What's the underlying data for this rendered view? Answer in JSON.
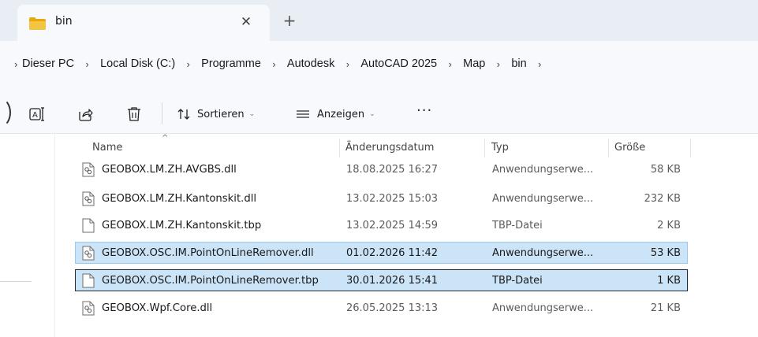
{
  "tab": {
    "title": "bin",
    "close_glyph": "✕",
    "new_tab_glyph": "+"
  },
  "breadcrumb": {
    "items": [
      "Dieser PC",
      "Local Disk (C:)",
      "Programme",
      "Autodesk",
      "AutoCAD 2025",
      "Map",
      "bin"
    ],
    "separator": "›"
  },
  "toolbar": {
    "sort_label": "Sortieren",
    "view_label": "Anzeigen",
    "more_label": "···",
    "chevron": "⌄"
  },
  "columns": {
    "name": "Name",
    "date": "Änderungsdatum",
    "type": "Typ",
    "size": "Größe",
    "sort_caret": "^"
  },
  "files": [
    {
      "name": "GEOBOX.LM.ZH.AVGBS.dll",
      "date": "18.08.2025 16:27",
      "type": "Anwendungserwe...",
      "size": "58 KB",
      "icon": "dll-file-icon",
      "state": "normal"
    },
    {
      "name": "GEOBOX.LM.ZH.Kantonskit.dll",
      "date": "13.02.2025 15:03",
      "type": "Anwendungserwe...",
      "size": "232 KB",
      "icon": "dll-file-icon",
      "state": "normal"
    },
    {
      "name": "GEOBOX.LM.ZH.Kantonskit.tbp",
      "date": "13.02.2025 14:59",
      "type": "TBP-Datei",
      "size": "2 KB",
      "icon": "blank-file-icon",
      "state": "normal"
    },
    {
      "name": "GEOBOX.OSC.IM.PointOnLineRemover.dll",
      "date": "01.02.2026 11:42",
      "type": "Anwendungserwe...",
      "size": "53 KB",
      "icon": "dll-file-icon",
      "state": "selected"
    },
    {
      "name": "GEOBOX.OSC.IM.PointOnLineRemover.tbp",
      "date": "30.01.2026 15:41",
      "type": "TBP-Datei",
      "size": "1 KB",
      "icon": "blank-file-icon",
      "state": "focused"
    },
    {
      "name": "GEOBOX.Wpf.Core.dll",
      "date": "26.05.2025 13:13",
      "type": "Anwendungserwe...",
      "size": "21 KB",
      "icon": "dll-file-icon",
      "state": "normal"
    }
  ],
  "colors": {
    "selection_fill": "#cce4f7",
    "selection_border": "#99c9ef",
    "focus_border": "#1e2a36",
    "folder_yellow": "#f4c542"
  }
}
